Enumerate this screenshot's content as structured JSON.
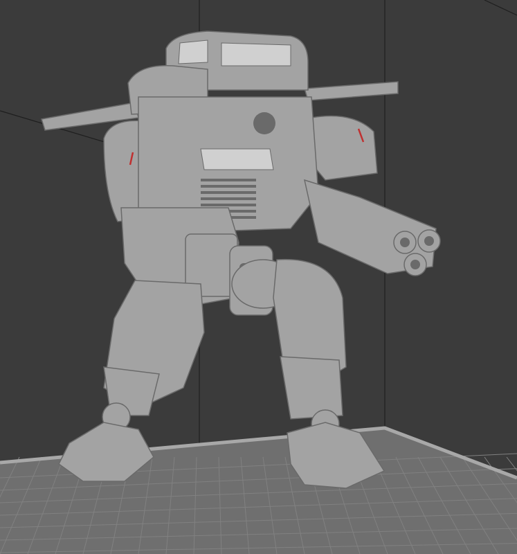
{
  "viewport": {
    "background": "#3b3b3b",
    "plate_color": "#6f6f6f",
    "plate_grid_color": "#818181",
    "plate_edge_color": "#a8a8a8",
    "model_color": "#a3a3a3",
    "model_shadow": "#6a6a6a",
    "model_highlight": "#d0d0d0",
    "axis_line_color": "#1e1e1e"
  }
}
